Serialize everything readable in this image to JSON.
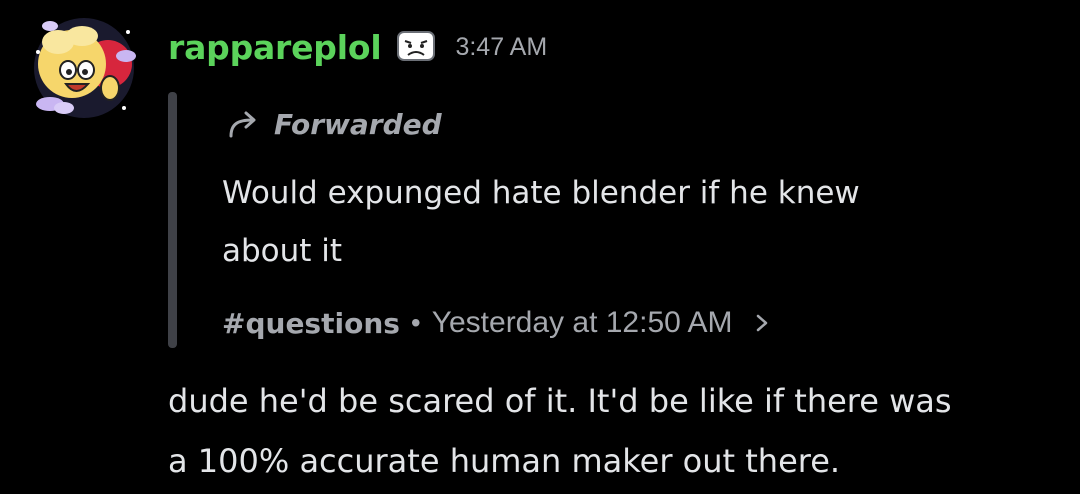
{
  "message": {
    "username": "rappareplol",
    "username_color": "#5bd35b",
    "badge_icon": "frowning-face-badge-icon",
    "timestamp": "3:47 AM",
    "avatar_icon": "cartoon-character-avatar",
    "forwarded": {
      "icon": "forward-arrow-icon",
      "label": "Forwarded",
      "text": "Would expunged hate blender if he knew\nabout it",
      "channel": "#questions",
      "separator": "•",
      "time": "Yesterday at 12:50 AM",
      "chevron_icon": "chevron-right-icon"
    },
    "content": "dude he'd be scared of it. It'd be like if there was\na 100% accurate human maker out there."
  },
  "colors": {
    "background": "#000000",
    "text": "#e3e5e8",
    "muted": "#a5a8ae",
    "forward_bar": "#3f4147"
  }
}
